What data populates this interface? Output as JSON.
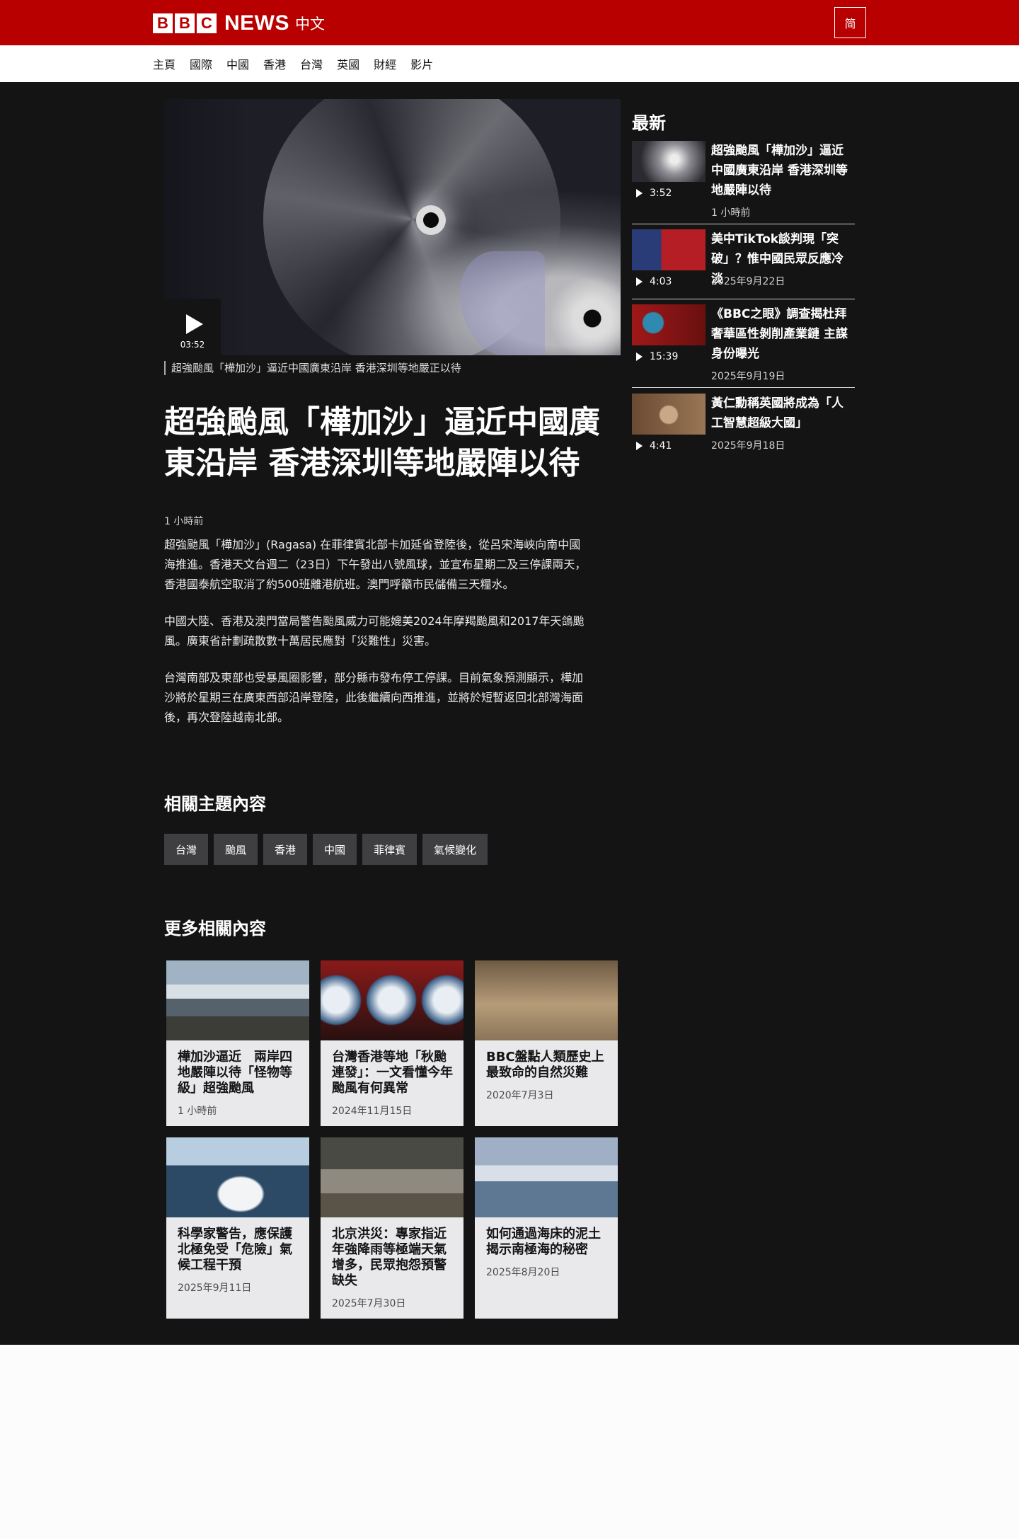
{
  "header": {
    "logo_letters": [
      "B",
      "B",
      "C"
    ],
    "logo_news": "NEWS",
    "logo_zh": "中文",
    "lang_toggle": "简"
  },
  "nav": {
    "items": [
      "主頁",
      "國際",
      "中國",
      "香港",
      "台灣",
      "英國",
      "財經",
      "影片"
    ]
  },
  "hero": {
    "duration": "03:52",
    "caption": "超強颱風「樺加沙」逼近中國廣東沿岸 香港深圳等地嚴正以待"
  },
  "article": {
    "headline": "超強颱風「樺加沙」逼近中國廣東沿岸 香港深圳等地嚴陣以待",
    "timestamp": "1 小時前",
    "paragraphs": [
      "超強颱風「樺加沙」(Ragasa) 在菲律賓北部卡加延省登陸後，從呂宋海峽向南中國海推進。香港天文台週二（23日）下午發出八號風球，並宣布星期二及三停課兩天，香港國泰航空取消了約500班離港航班。澳門呼籲市民儲備三天糧水。",
      "中國大陸、香港及澳門當局警告颱風威力可能媲美2024年摩羯颱風和2017年天鴿颱風。廣東省計劃疏散數十萬居民應對「災難性」災害。",
      "台灣南部及東部也受暴風圈影響，部分縣市發布停工停課。目前氣象預測顯示，樺加沙將於星期三在廣東西部沿岸登陸，此後繼續向西推進，並將於短暫返回北部灣海面後，再次登陸越南北部。"
    ]
  },
  "related_topics": {
    "title": "相關主題內容",
    "tags": [
      "台灣",
      "颱風",
      "香港",
      "中國",
      "菲律賓",
      "氣候變化"
    ]
  },
  "more": {
    "title": "更多相關內容",
    "cards": [
      {
        "title": "樺加沙逼近　兩岸四地嚴陣以待「怪物等級」超強颱風",
        "date": "1 小時前"
      },
      {
        "title": "台灣香港等地「秋颱連發」：一文看懂今年颱風有何異常",
        "date": "2024年11月15日"
      },
      {
        "title": "BBC盤點人類歷史上最致命的自然災難",
        "date": "2020年7月3日"
      },
      {
        "title": "科學家警告，應保護北極免受「危險」氣候工程干預",
        "date": "2025年9月11日"
      },
      {
        "title": "北京洪災：專家指近年強降雨等極端天氣增多，民眾抱怨預警缺失",
        "date": "2025年7月30日"
      },
      {
        "title": "如何通過海床的泥土揭示南極海的秘密",
        "date": "2025年8月20日"
      }
    ]
  },
  "latest": {
    "title": "最新",
    "items": [
      {
        "title": "超強颱風「樺加沙」逼近中國廣東沿岸 香港深圳等地嚴陣以待",
        "duration": "3:52",
        "date": "1 小時前"
      },
      {
        "title": "美中TikTok談判現「突破」？惟中國民眾反應冷淡",
        "duration": "4:03",
        "date": "2025年9月22日"
      },
      {
        "title": "《BBC之眼》調查揭杜拜奢華區性剝削產業鏈 主謀身份曝光",
        "duration": "15:39",
        "date": "2025年9月19日"
      },
      {
        "title": "黃仁勳稱英國將成為「人工智慧超級大國」",
        "duration": "4:41",
        "date": "2025年9月18日"
      }
    ]
  },
  "colors": {
    "brand_red": "#b80000",
    "page_dark": "#141414",
    "tag_bg": "#3f3f42",
    "card_bg": "#e9e9ec"
  }
}
